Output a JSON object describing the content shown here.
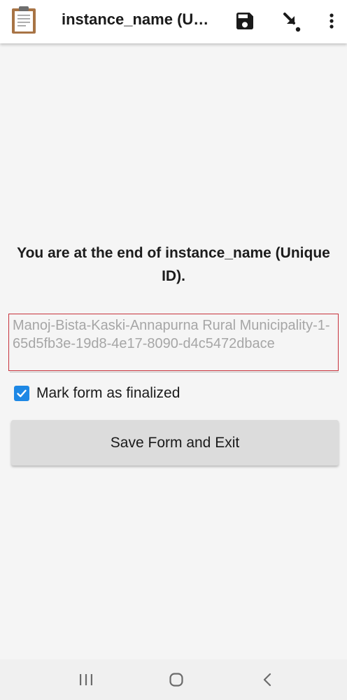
{
  "app_bar": {
    "title": "instance_name (Unique ID)",
    "icons": {
      "app": "clipboard-icon",
      "save": "save-icon",
      "goto": "go-to-prompt-icon",
      "more": "more-vert-icon"
    }
  },
  "end_screen": {
    "message": "You are at the end of instance_name (Unique ID).",
    "instance_name_value": "Manoj-Bista-Kaski-Annapurna Rural Municipality-1-65d5fb3e-19d8-4e17-8090-d4c5472dbace",
    "finalize_checkbox": {
      "label": "Mark form as finalized",
      "checked": true
    },
    "save_exit_label": "Save Form and Exit"
  },
  "nav_bar": {
    "icons": [
      "recent-apps-icon",
      "home-icon",
      "back-icon"
    ]
  },
  "colors": {
    "accent": "#1e88e5",
    "error_border": "#c8323c",
    "input_text": "#a6a6a6",
    "button_bg": "#dcdcdc",
    "background": "#f5f5f5"
  }
}
